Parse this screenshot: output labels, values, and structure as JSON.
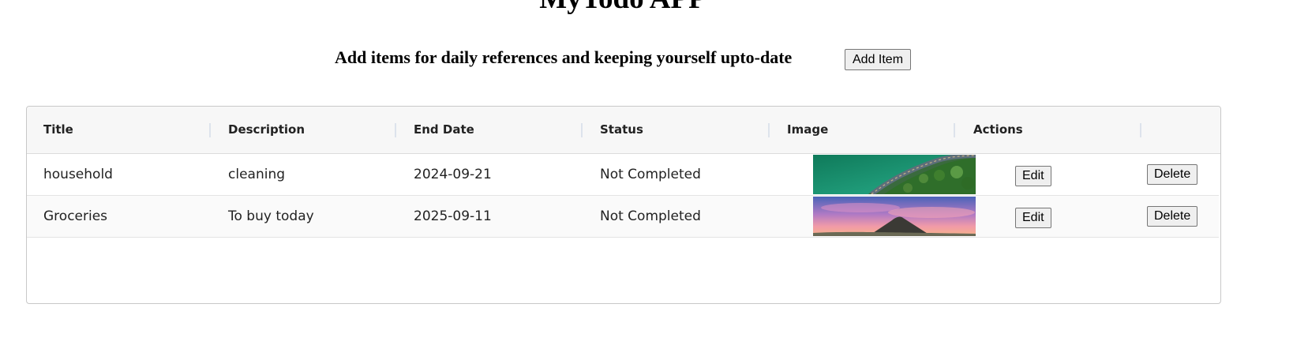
{
  "app": {
    "title": "MyTodo APP",
    "subtitle": "Add items for daily references and keeping yourself upto-date",
    "add_button": "Add Item"
  },
  "table": {
    "columns": [
      "Title",
      "Description",
      "End Date",
      "Status",
      "Image",
      "Actions"
    ],
    "rows": [
      {
        "title": "household",
        "description": "cleaning",
        "end_date": "2024-09-21",
        "status": "Not Completed",
        "image_subject": "aerial coastline road with turquoise water and forest",
        "edit_label": "Edit",
        "delete_label": "Delete"
      },
      {
        "title": "Groceries",
        "description": "To buy today",
        "end_date": "2025-09-11",
        "status": "Not Completed",
        "image_subject": "mountain under pink sunset sky",
        "edit_label": "Edit",
        "delete_label": "Delete"
      }
    ]
  },
  "colors": {
    "header_bg": "#f7f7f7",
    "border": "#c8c8c8",
    "text": "#222222",
    "button_bg": "#efefef"
  }
}
